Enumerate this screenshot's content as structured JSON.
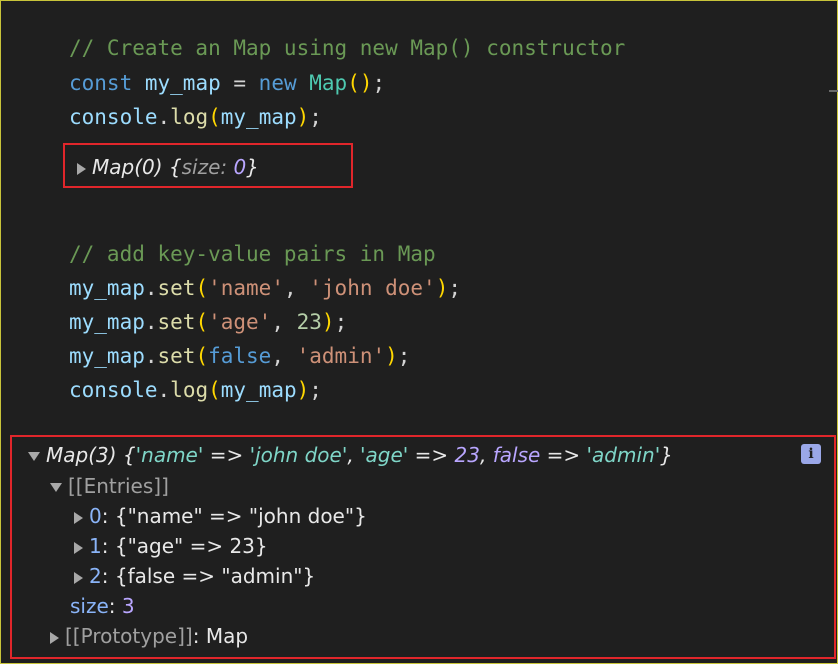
{
  "code": {
    "comment1": "// Create an Map using new Map() constructor",
    "kw_const": "const",
    "var_map": "my_map",
    "eq": " = ",
    "kw_new": "new",
    "cls_map": "Map",
    "console": "console",
    "log": "log",
    "set": "set",
    "comment2": "// add key-value pairs in Map",
    "str_name": "'name'",
    "str_john": "'john doe'",
    "str_age": "'age'",
    "num_23": "23",
    "kw_false": "false",
    "str_admin": "'admin'"
  },
  "console_output1": {
    "prefix": "Map(0)",
    "size_label": "size",
    "size_value": "0"
  },
  "console_output2": {
    "prefix": "Map(3)",
    "k1": "'name'",
    "v1": "'john doe'",
    "k2": "'age'",
    "v2": "23",
    "k3": "false",
    "v3": "'admin'",
    "arrow": " => ",
    "entries_label": "[[Entries]]",
    "entries": [
      {
        "index": "0",
        "key": "\"name\"",
        "value": "\"john doe\""
      },
      {
        "index": "1",
        "key": "\"age\"",
        "value": "23"
      },
      {
        "index": "2",
        "key": "false",
        "value": "\"admin\""
      }
    ],
    "size_label": "size",
    "size_value": "3",
    "prototype_label": "[[Prototype]]",
    "prototype_value": "Map",
    "info_icon": "i"
  },
  "colors": {
    "background": "#1f1f1f",
    "highlight_border": "#e0262b",
    "frame_border": "#c8c43a"
  }
}
